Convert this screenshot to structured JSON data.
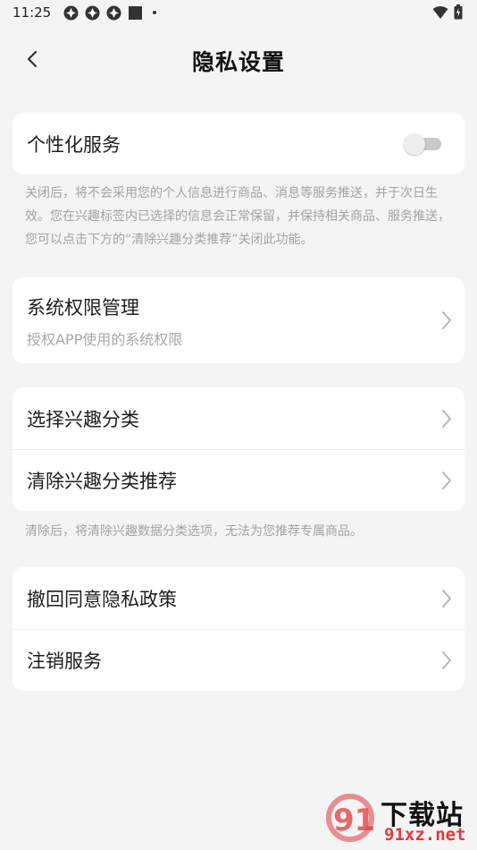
{
  "status_bar": {
    "time": "11:25",
    "icons": [
      "notification-icon",
      "notification-icon",
      "notification-icon",
      "square-icon",
      "dot-icon"
    ],
    "right_icons": [
      "wifi-icon",
      "battery-icon"
    ]
  },
  "header": {
    "title": "隐私设置",
    "back_icon": "chevron-left-icon"
  },
  "personalized": {
    "label": "个性化服务",
    "toggle_on": false,
    "note": "关闭后，将不会采用您的个人信息进行商品、消息等服务推送，并于次日生效。您在兴趣标签内已选择的信息会正常保留，并保持相关商品、服务推送，您可以点击下方的“清除兴趣分类推荐”关闭此功能。"
  },
  "permissions": {
    "title": "系统权限管理",
    "subtitle": "授权APP使用的系统权限"
  },
  "interest": {
    "items": [
      {
        "label": "选择兴趣分类"
      },
      {
        "label": "清除兴趣分类推荐"
      }
    ],
    "note": "清除后，将清除兴趣数据分类选项，无法为您推荐专属商品。"
  },
  "account": {
    "items": [
      {
        "label": "撤回同意隐私政策"
      },
      {
        "label": "注销服务"
      }
    ]
  },
  "watermark": {
    "text_cn": "下载站",
    "text_url": "91xz.net",
    "mark": "91"
  },
  "colors": {
    "background": "#f4f4f4",
    "card": "#ffffff",
    "toggle_off": "#c9c9c9",
    "note_text": "#a3a3a3",
    "watermark_red": "#e0393e"
  }
}
